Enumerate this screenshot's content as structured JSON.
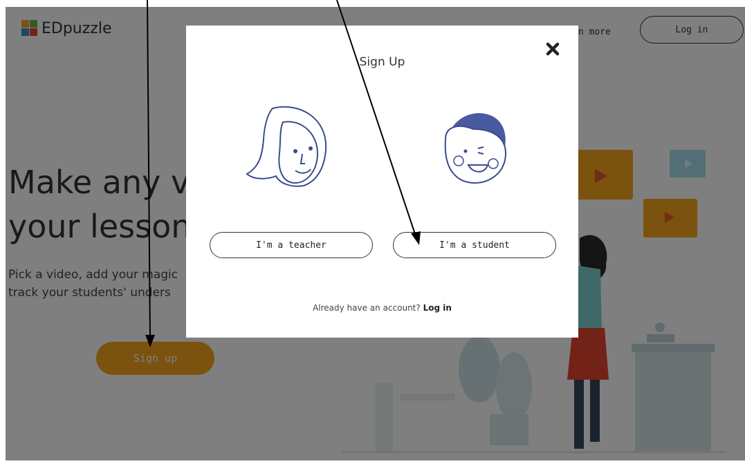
{
  "brand": {
    "logo_text": "EDpuzzle",
    "logo_icon": "puzzle-icon",
    "accent": "#f7a51d"
  },
  "header": {
    "learn_more": "rn more",
    "login": "Log in"
  },
  "hero": {
    "line1": "Make any vi",
    "line2": "your lesson",
    "sub1": "Pick a video, add your magic",
    "sub2": "track your students' unders",
    "signup": "Sign up"
  },
  "modal": {
    "title": "Sign Up",
    "close_icon": "close-icon",
    "teacher": "I'm a teacher",
    "student": "I'm a student",
    "already": "Already have an account?",
    "login": "Log in"
  }
}
